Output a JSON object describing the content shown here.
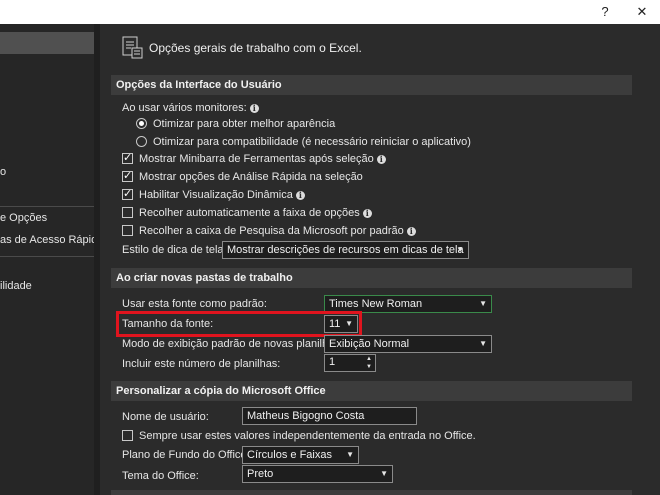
{
  "window": {
    "help_glyph": "?",
    "close_glyph": "✕"
  },
  "sidebar": {
    "items": [
      {
        "label": ""
      },
      {
        "label": "o"
      },
      {
        "label": "e Opções"
      },
      {
        "label": "as de Acesso Rápido"
      },
      {
        "label": "ilidade"
      }
    ]
  },
  "main": {
    "header": "Opções gerais de trabalho com o Excel.",
    "sections": {
      "ui": "Opções da Interface do Usuário",
      "new_workbooks": "Ao criar novas pastas de trabalho",
      "personalize": "Personalizar a cópia do Microsoft Office"
    },
    "ui": {
      "multi_monitor_label": "Ao usar vários monitores:",
      "radio_appearance": "Otimizar para obter melhor aparência",
      "radio_compat": "Otimizar para compatibilidade (é necessário reiniciar o aplicativo)",
      "cb_minibar": "Mostrar Minibarra de Ferramentas após seleção",
      "cb_quick_analysis": "Mostrar opções de Análise Rápida na seleção",
      "cb_live_preview": "Habilitar Visualização Dinâmica",
      "cb_collapse_ribbon": "Recolher automaticamente a faixa de opções",
      "cb_collapse_search": "Recolher a caixa de Pesquisa da Microsoft por padrão",
      "tooltip_label": "Estilo de dica de tela:",
      "tooltip_value": "Mostrar descrições de recursos em dicas de tela"
    },
    "new_workbooks": {
      "font_label": "Usar esta fonte como padrão:",
      "font_value": "Times New Roman",
      "font_size_label": "Tamanho da fonte:",
      "font_size_value": "11",
      "view_label": "Modo de exibição padrão de novas planilhas:",
      "view_value": "Exibição Normal",
      "sheets_label": "Incluir este número de planilhas:",
      "sheets_value": "1"
    },
    "personalize": {
      "username_label": "Nome de usuário:",
      "username_value": "Matheus Bigogno Costa",
      "always_use_label": "Sempre usar estes valores independentemente da entrada no Office.",
      "background_label": "Plano de Fundo do Office:",
      "background_value": "Círculos e Faixas",
      "theme_label": "Tema do Office:",
      "theme_value": "Preto"
    }
  },
  "colors": {
    "highlight_box": "#e0141e",
    "window_bg": "#2b2b2b",
    "section_bg": "#3c3c3c"
  },
  "icons": {
    "header": "general-options-icon",
    "info": "info-icon",
    "dropdown": "chevron-down-icon"
  }
}
